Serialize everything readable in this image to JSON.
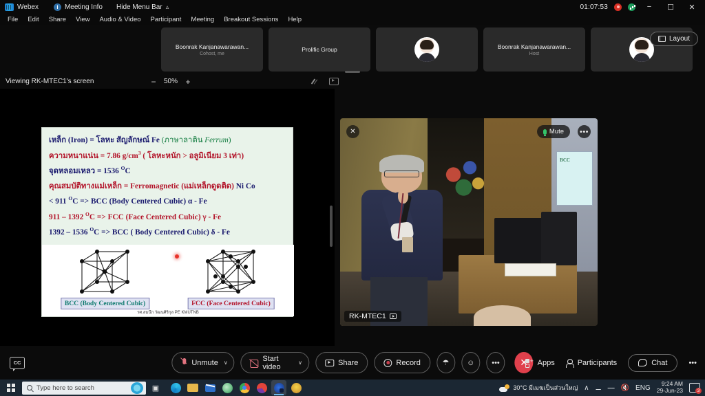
{
  "titlebar": {
    "app_name": "Webex",
    "meeting_info": "Meeting Info",
    "hide_menu_bar": "Hide Menu Bar",
    "timer": "01:07:53",
    "minimize": "−",
    "maximize": "❐",
    "close": "✕"
  },
  "menubar": {
    "items": [
      {
        "label": "File"
      },
      {
        "label": "Edit"
      },
      {
        "label": "Share"
      },
      {
        "label": "View"
      },
      {
        "label": "Audio & Video"
      },
      {
        "label": "Participant"
      },
      {
        "label": "Meeting"
      },
      {
        "label": "Breakout Sessions"
      },
      {
        "label": "Help"
      }
    ]
  },
  "filmstrip": {
    "participants": [
      {
        "name": "Boonrak Kanjanawarawan...",
        "role": "Cohost, me",
        "has_avatar": false
      },
      {
        "name": "Prolific Group",
        "role": "",
        "has_avatar": false
      },
      {
        "name": "",
        "role": "",
        "has_avatar": true
      },
      {
        "name": "Boonrak Kanjanawarawan...",
        "role": "Host",
        "has_avatar": false
      },
      {
        "name": "",
        "role": "",
        "has_avatar": true
      }
    ],
    "layout_button": "Layout"
  },
  "viewbar": {
    "label": "Viewing RK-MTEC1's screen",
    "zoom_out": "−",
    "zoom_value": "50%",
    "zoom_in": "+"
  },
  "slide": {
    "lines": [
      {
        "id": "line1",
        "parts": [
          {
            "text": "เหล็ก (Iron)  = โลหะ สัญลักษณ์  Fe ",
            "color": "navy"
          },
          {
            "text": "(ภาษาลาติน ",
            "color": "green"
          },
          {
            "text": "Ferrum",
            "color": "green",
            "italic": true
          },
          {
            "text": ")",
            "color": "green"
          }
        ]
      },
      {
        "id": "line2",
        "parts": [
          {
            "text": "ความหนาแน่น = 7.86  g/cm",
            "color": "red"
          },
          {
            "text": "3",
            "color": "red",
            "sup": true
          },
          {
            "text": " ( โลหะหนัก > อลูมิเนียม 3 เท่า)",
            "color": "red"
          }
        ]
      },
      {
        "id": "line3",
        "parts": [
          {
            "text": "จุดหลอมเหลว = 1536 ",
            "color": "navy"
          },
          {
            "text": "O",
            "color": "navy",
            "sup": true
          },
          {
            "text": "C",
            "color": "navy"
          }
        ]
      },
      {
        "id": "line4",
        "parts": [
          {
            "text": "คุณสมบัติทางแม่เหล็ก = Ferromagnetic (แม่เหล็กดูดติด)    ",
            "color": "red"
          },
          {
            "text": "Ni  Co",
            "color": "navy"
          }
        ]
      },
      {
        "id": "line5",
        "parts": [
          {
            "text": "< 911 ",
            "color": "navy"
          },
          {
            "text": "O",
            "color": "navy",
            "sup": true
          },
          {
            "text": "C => BCC (Body Centered Cubic) α - Fe",
            "color": "navy"
          }
        ]
      },
      {
        "id": "line6",
        "parts": [
          {
            "text": "911 – 1392 ",
            "color": "red"
          },
          {
            "text": "O",
            "color": "red",
            "sup": true
          },
          {
            "text": "C => FCC (Face Centered Cubic) γ - Fe",
            "color": "red"
          }
        ]
      },
      {
        "id": "line7",
        "parts": [
          {
            "text": "1392 – 1536 ",
            "color": "navy"
          },
          {
            "text": "O",
            "color": "navy",
            "sup": true
          },
          {
            "text": "C => BCC ( Body Centered Cubic) δ - Fe",
            "color": "navy"
          }
        ]
      }
    ],
    "figures": [
      {
        "caption": "BCC (Body Centered Cubic)",
        "caption_color": "#0f7a6e"
      },
      {
        "caption": "FCC (Face Centered Cubic)",
        "caption_color": "#b3142a"
      }
    ],
    "credit": "รศ.สมนึก  วัฒนศิริกุล  PE  KMUTNB"
  },
  "video": {
    "participant_name": "RK-MTEC1",
    "mute_label": "Mute",
    "more_label": "•••",
    "pin_icon": "✕"
  },
  "controls": {
    "cc_label": "CC",
    "unmute": "Unmute",
    "start_video": "Start video",
    "share": "Share",
    "record": "Record",
    "attach": "☂",
    "reaction": "☺",
    "more": "•••",
    "end_call": "✕",
    "apps": "Apps",
    "participants": "Participants",
    "chat": "Chat",
    "right_more": "•••",
    "caret": "∨"
  },
  "taskbar": {
    "search_placeholder": "Type here to search",
    "weather": "30°C  มีเมฆเป็นส่วนใหญ่",
    "tray_chevron": "∧",
    "language": "ENG",
    "time": "9:24 AM",
    "date": "29-Jun-23",
    "notification_count": "3"
  }
}
